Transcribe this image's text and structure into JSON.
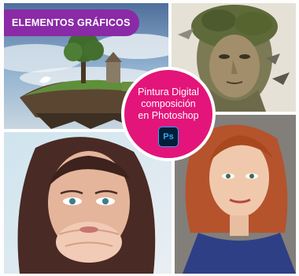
{
  "banner": {
    "label": "ELEMENTOS GRÁFICOS",
    "color": "#8a2aa6"
  },
  "badge": {
    "line1": "Pintura Digital",
    "line2": "composición",
    "line3": "en Photoshop",
    "color": "#e3157a",
    "icon": "photoshop-icon",
    "icon_text": "Ps"
  }
}
